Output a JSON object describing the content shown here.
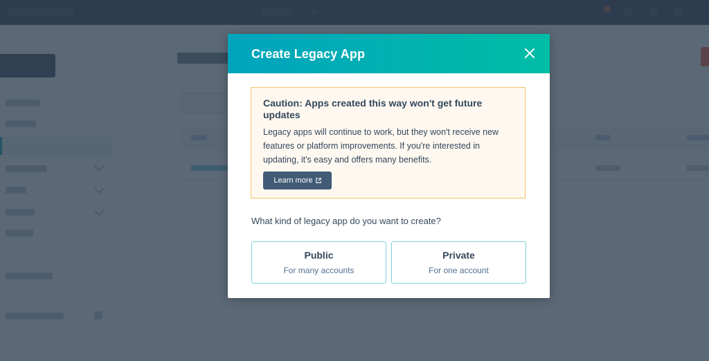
{
  "modal": {
    "title": "Create Legacy App",
    "close_icon": "close-icon",
    "alert": {
      "title": "Caution: Apps created this way won't get future updates",
      "body": "Legacy apps will continue to work, but they won't receive new features or platform improvements. If you're interested in updating, it's easy and offers many benefits.",
      "button_label": "Learn more",
      "button_icon": "external-link-icon"
    },
    "question": "What kind of legacy app do you want to create?",
    "options": [
      {
        "title": "Public",
        "subtitle": "For many accounts"
      },
      {
        "title": "Private",
        "subtitle": "For one account"
      }
    ]
  },
  "colors": {
    "header_gradient_start": "#00a4bd",
    "header_gradient_end": "#00bda5",
    "alert_border": "#f5c26b",
    "alert_bg": "#fef8f0",
    "button_bg": "#425b76",
    "option_border": "#7fd1de",
    "text": "#33475b"
  }
}
